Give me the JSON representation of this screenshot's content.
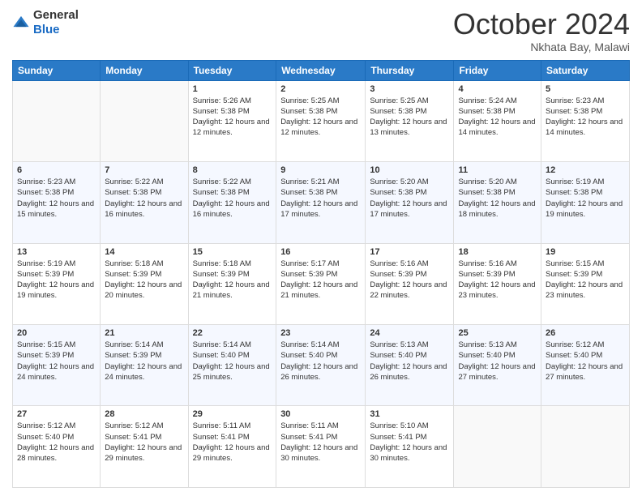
{
  "logo": {
    "general": "General",
    "blue": "Blue"
  },
  "header": {
    "month_title": "October 2024",
    "location": "Nkhata Bay, Malawi"
  },
  "days_of_week": [
    "Sunday",
    "Monday",
    "Tuesday",
    "Wednesday",
    "Thursday",
    "Friday",
    "Saturday"
  ],
  "weeks": [
    [
      {
        "day": "",
        "sunrise": "",
        "sunset": "",
        "daylight": ""
      },
      {
        "day": "",
        "sunrise": "",
        "sunset": "",
        "daylight": ""
      },
      {
        "day": "1",
        "sunrise": "Sunrise: 5:26 AM",
        "sunset": "Sunset: 5:38 PM",
        "daylight": "Daylight: 12 hours and 12 minutes."
      },
      {
        "day": "2",
        "sunrise": "Sunrise: 5:25 AM",
        "sunset": "Sunset: 5:38 PM",
        "daylight": "Daylight: 12 hours and 12 minutes."
      },
      {
        "day": "3",
        "sunrise": "Sunrise: 5:25 AM",
        "sunset": "Sunset: 5:38 PM",
        "daylight": "Daylight: 12 hours and 13 minutes."
      },
      {
        "day": "4",
        "sunrise": "Sunrise: 5:24 AM",
        "sunset": "Sunset: 5:38 PM",
        "daylight": "Daylight: 12 hours and 14 minutes."
      },
      {
        "day": "5",
        "sunrise": "Sunrise: 5:23 AM",
        "sunset": "Sunset: 5:38 PM",
        "daylight": "Daylight: 12 hours and 14 minutes."
      }
    ],
    [
      {
        "day": "6",
        "sunrise": "Sunrise: 5:23 AM",
        "sunset": "Sunset: 5:38 PM",
        "daylight": "Daylight: 12 hours and 15 minutes."
      },
      {
        "day": "7",
        "sunrise": "Sunrise: 5:22 AM",
        "sunset": "Sunset: 5:38 PM",
        "daylight": "Daylight: 12 hours and 16 minutes."
      },
      {
        "day": "8",
        "sunrise": "Sunrise: 5:22 AM",
        "sunset": "Sunset: 5:38 PM",
        "daylight": "Daylight: 12 hours and 16 minutes."
      },
      {
        "day": "9",
        "sunrise": "Sunrise: 5:21 AM",
        "sunset": "Sunset: 5:38 PM",
        "daylight": "Daylight: 12 hours and 17 minutes."
      },
      {
        "day": "10",
        "sunrise": "Sunrise: 5:20 AM",
        "sunset": "Sunset: 5:38 PM",
        "daylight": "Daylight: 12 hours and 17 minutes."
      },
      {
        "day": "11",
        "sunrise": "Sunrise: 5:20 AM",
        "sunset": "Sunset: 5:38 PM",
        "daylight": "Daylight: 12 hours and 18 minutes."
      },
      {
        "day": "12",
        "sunrise": "Sunrise: 5:19 AM",
        "sunset": "Sunset: 5:38 PM",
        "daylight": "Daylight: 12 hours and 19 minutes."
      }
    ],
    [
      {
        "day": "13",
        "sunrise": "Sunrise: 5:19 AM",
        "sunset": "Sunset: 5:39 PM",
        "daylight": "Daylight: 12 hours and 19 minutes."
      },
      {
        "day": "14",
        "sunrise": "Sunrise: 5:18 AM",
        "sunset": "Sunset: 5:39 PM",
        "daylight": "Daylight: 12 hours and 20 minutes."
      },
      {
        "day": "15",
        "sunrise": "Sunrise: 5:18 AM",
        "sunset": "Sunset: 5:39 PM",
        "daylight": "Daylight: 12 hours and 21 minutes."
      },
      {
        "day": "16",
        "sunrise": "Sunrise: 5:17 AM",
        "sunset": "Sunset: 5:39 PM",
        "daylight": "Daylight: 12 hours and 21 minutes."
      },
      {
        "day": "17",
        "sunrise": "Sunrise: 5:16 AM",
        "sunset": "Sunset: 5:39 PM",
        "daylight": "Daylight: 12 hours and 22 minutes."
      },
      {
        "day": "18",
        "sunrise": "Sunrise: 5:16 AM",
        "sunset": "Sunset: 5:39 PM",
        "daylight": "Daylight: 12 hours and 23 minutes."
      },
      {
        "day": "19",
        "sunrise": "Sunrise: 5:15 AM",
        "sunset": "Sunset: 5:39 PM",
        "daylight": "Daylight: 12 hours and 23 minutes."
      }
    ],
    [
      {
        "day": "20",
        "sunrise": "Sunrise: 5:15 AM",
        "sunset": "Sunset: 5:39 PM",
        "daylight": "Daylight: 12 hours and 24 minutes."
      },
      {
        "day": "21",
        "sunrise": "Sunrise: 5:14 AM",
        "sunset": "Sunset: 5:39 PM",
        "daylight": "Daylight: 12 hours and 24 minutes."
      },
      {
        "day": "22",
        "sunrise": "Sunrise: 5:14 AM",
        "sunset": "Sunset: 5:40 PM",
        "daylight": "Daylight: 12 hours and 25 minutes."
      },
      {
        "day": "23",
        "sunrise": "Sunrise: 5:14 AM",
        "sunset": "Sunset: 5:40 PM",
        "daylight": "Daylight: 12 hours and 26 minutes."
      },
      {
        "day": "24",
        "sunrise": "Sunrise: 5:13 AM",
        "sunset": "Sunset: 5:40 PM",
        "daylight": "Daylight: 12 hours and 26 minutes."
      },
      {
        "day": "25",
        "sunrise": "Sunrise: 5:13 AM",
        "sunset": "Sunset: 5:40 PM",
        "daylight": "Daylight: 12 hours and 27 minutes."
      },
      {
        "day": "26",
        "sunrise": "Sunrise: 5:12 AM",
        "sunset": "Sunset: 5:40 PM",
        "daylight": "Daylight: 12 hours and 27 minutes."
      }
    ],
    [
      {
        "day": "27",
        "sunrise": "Sunrise: 5:12 AM",
        "sunset": "Sunset: 5:40 PM",
        "daylight": "Daylight: 12 hours and 28 minutes."
      },
      {
        "day": "28",
        "sunrise": "Sunrise: 5:12 AM",
        "sunset": "Sunset: 5:41 PM",
        "daylight": "Daylight: 12 hours and 29 minutes."
      },
      {
        "day": "29",
        "sunrise": "Sunrise: 5:11 AM",
        "sunset": "Sunset: 5:41 PM",
        "daylight": "Daylight: 12 hours and 29 minutes."
      },
      {
        "day": "30",
        "sunrise": "Sunrise: 5:11 AM",
        "sunset": "Sunset: 5:41 PM",
        "daylight": "Daylight: 12 hours and 30 minutes."
      },
      {
        "day": "31",
        "sunrise": "Sunrise: 5:10 AM",
        "sunset": "Sunset: 5:41 PM",
        "daylight": "Daylight: 12 hours and 30 minutes."
      },
      {
        "day": "",
        "sunrise": "",
        "sunset": "",
        "daylight": ""
      },
      {
        "day": "",
        "sunrise": "",
        "sunset": "",
        "daylight": ""
      }
    ]
  ]
}
